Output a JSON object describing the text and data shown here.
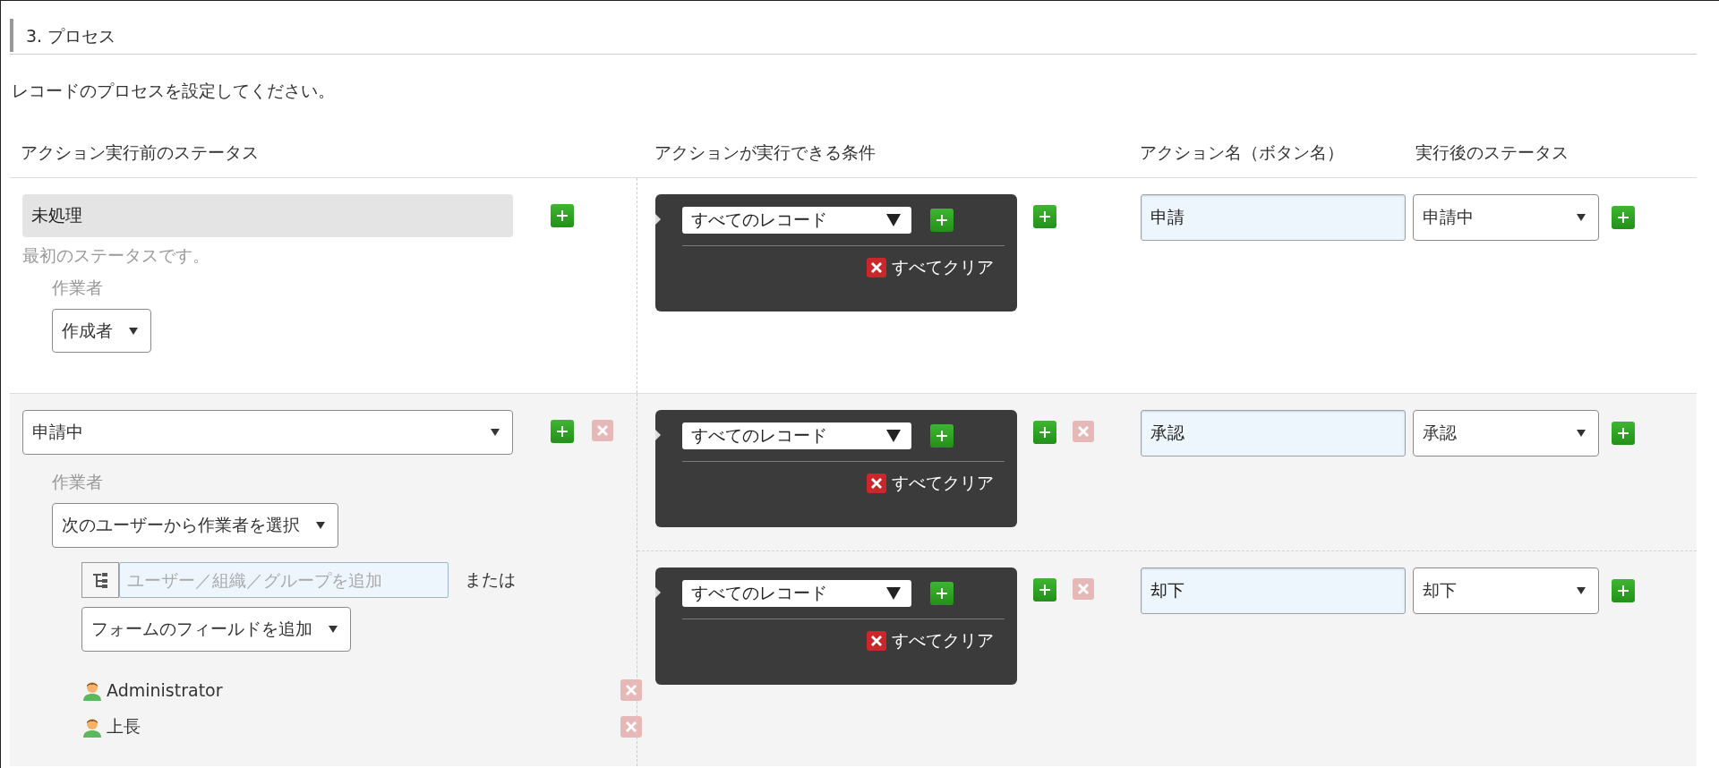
{
  "section": {
    "title": "3. プロセス",
    "description": "レコードのプロセスを設定してください。"
  },
  "columns": [
    "アクション実行前のステータス",
    "アクションが実行できる条件",
    "アクション名（ボタン名）",
    "実行後のステータス"
  ],
  "rows": [
    {
      "status": {
        "kind": "fixed",
        "value": "未処理",
        "note": "最初のステータスです。"
      },
      "removable": false,
      "assignee": {
        "label": "作業者",
        "mode": "作成者"
      },
      "actions": [
        {
          "condition": "すべてのレコード",
          "clear": "すべてクリア",
          "name": "申請",
          "next_status": "申請中",
          "removable": false
        }
      ]
    },
    {
      "status": {
        "kind": "select",
        "value": "申請中"
      },
      "removable": true,
      "assignee": {
        "label": "作業者",
        "mode": "次のユーザーから作業者を選択",
        "user_placeholder": "ユーザー／組織／グループを追加",
        "or": "または",
        "field_select": "フォームのフィールドを追加",
        "users": [
          {
            "name": "Administrator"
          },
          {
            "name": "上長"
          }
        ]
      },
      "actions": [
        {
          "condition": "すべてのレコード",
          "clear": "すべてクリア",
          "name": "承認",
          "next_status": "承認",
          "removable": true
        },
        {
          "condition": "すべてのレコード",
          "clear": "すべてクリア",
          "name": "却下",
          "next_status": "却下",
          "removable": true
        }
      ]
    }
  ]
}
